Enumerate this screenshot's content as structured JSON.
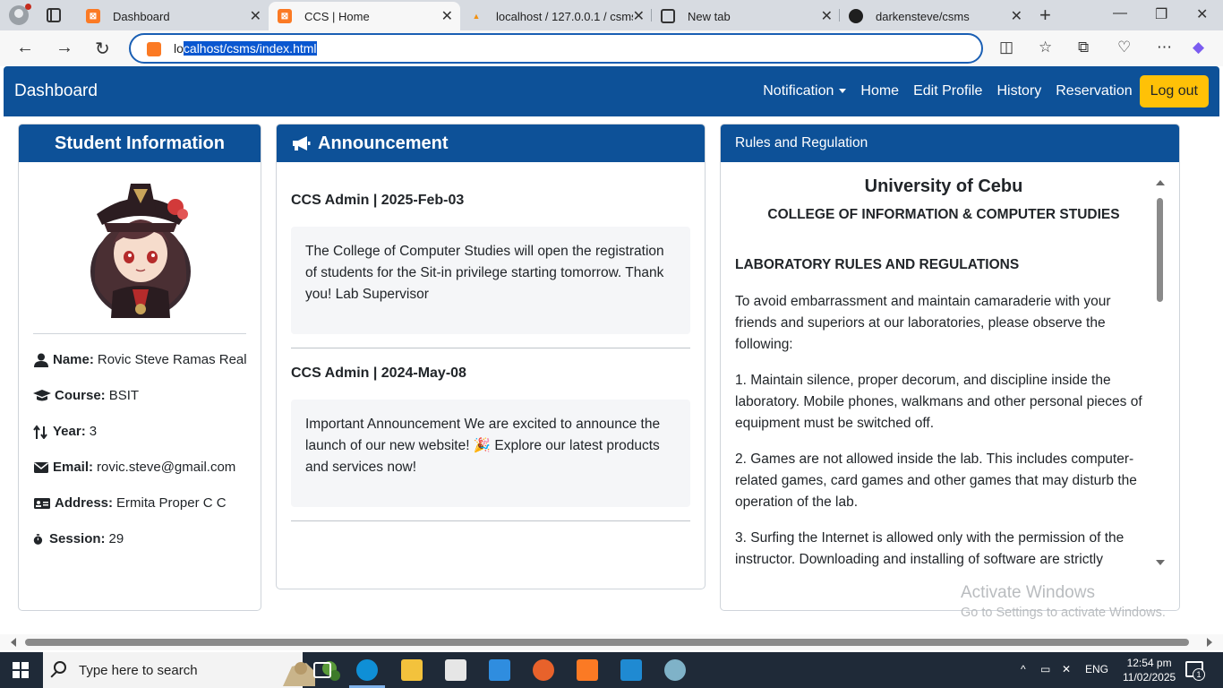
{
  "browser": {
    "tabs": [
      {
        "title": "Dashboard"
      },
      {
        "title": "CCS | Home"
      },
      {
        "title": "localhost / 127.0.0.1 / csms /"
      },
      {
        "title": "New tab"
      },
      {
        "title": "darkensteve/csms"
      }
    ],
    "url_prefix": "lo",
    "url_selected": "calhost/csms/index.html"
  },
  "navbar": {
    "brand": "Dashboard",
    "links": [
      "Notification",
      "Home",
      "Edit Profile",
      "History",
      "Reservation"
    ],
    "logout": "Log out"
  },
  "student": {
    "heading": "Student Information",
    "fields": [
      {
        "icon": "user-icon",
        "label": "Name:",
        "value": "Rovic Steve Ramas Real"
      },
      {
        "icon": "graduation-cap-icon",
        "label": "Course:",
        "value": "BSIT"
      },
      {
        "icon": "year-icon",
        "label": "Year:",
        "value": "3"
      },
      {
        "icon": "envelope-icon",
        "label": "Email:",
        "value": "rovic.steve@gmail.com"
      },
      {
        "icon": "id-card-icon",
        "label": "Address:",
        "value": "Ermita Proper C C"
      },
      {
        "icon": "stopwatch-icon",
        "label": "Session:",
        "value": "29"
      }
    ]
  },
  "announcement": {
    "heading": "Announcement",
    "items": [
      {
        "meta": "CCS Admin | 2025-Feb-03",
        "body": "The College of Computer Studies will open the registration of students for the Sit-in privilege starting tomorrow. Thank you! Lab Supervisor"
      },
      {
        "meta": "CCS Admin | 2024-May-08",
        "body": "Important Announcement We are excited to announce the launch of our new website! 🎉 Explore our latest products and services now!"
      }
    ]
  },
  "rules": {
    "heading": "Rules and Regulation",
    "university": "University of Cebu",
    "college": "COLLEGE OF INFORMATION & COMPUTER STUDIES",
    "title": "LABORATORY RULES AND REGULATIONS",
    "paragraphs": [
      "To avoid embarrassment and maintain camaraderie with your friends and superiors at our laboratories, please observe the following:",
      "1. Maintain silence, proper decorum, and discipline inside the laboratory. Mobile phones, walkmans and other personal pieces of equipment must be switched off.",
      "2. Games are not allowed inside the lab. This includes computer-related games, card games and other games that may disturb the operation of the lab.",
      "3. Surfing the Internet is allowed only with the permission of the instructor. Downloading and installing of software are strictly"
    ]
  },
  "watermark": {
    "line1": "Activate Windows",
    "line2": "Go to Settings to activate Windows."
  },
  "taskbar": {
    "search_placeholder": "Type here to search",
    "lang": "ENG",
    "time": "12:54 pm",
    "date": "11/02/2025",
    "notification_count": "1"
  },
  "colors": {
    "primary": "#0d5198",
    "logout": "#ffc107",
    "omnibox_border": "#1a5fb4"
  }
}
